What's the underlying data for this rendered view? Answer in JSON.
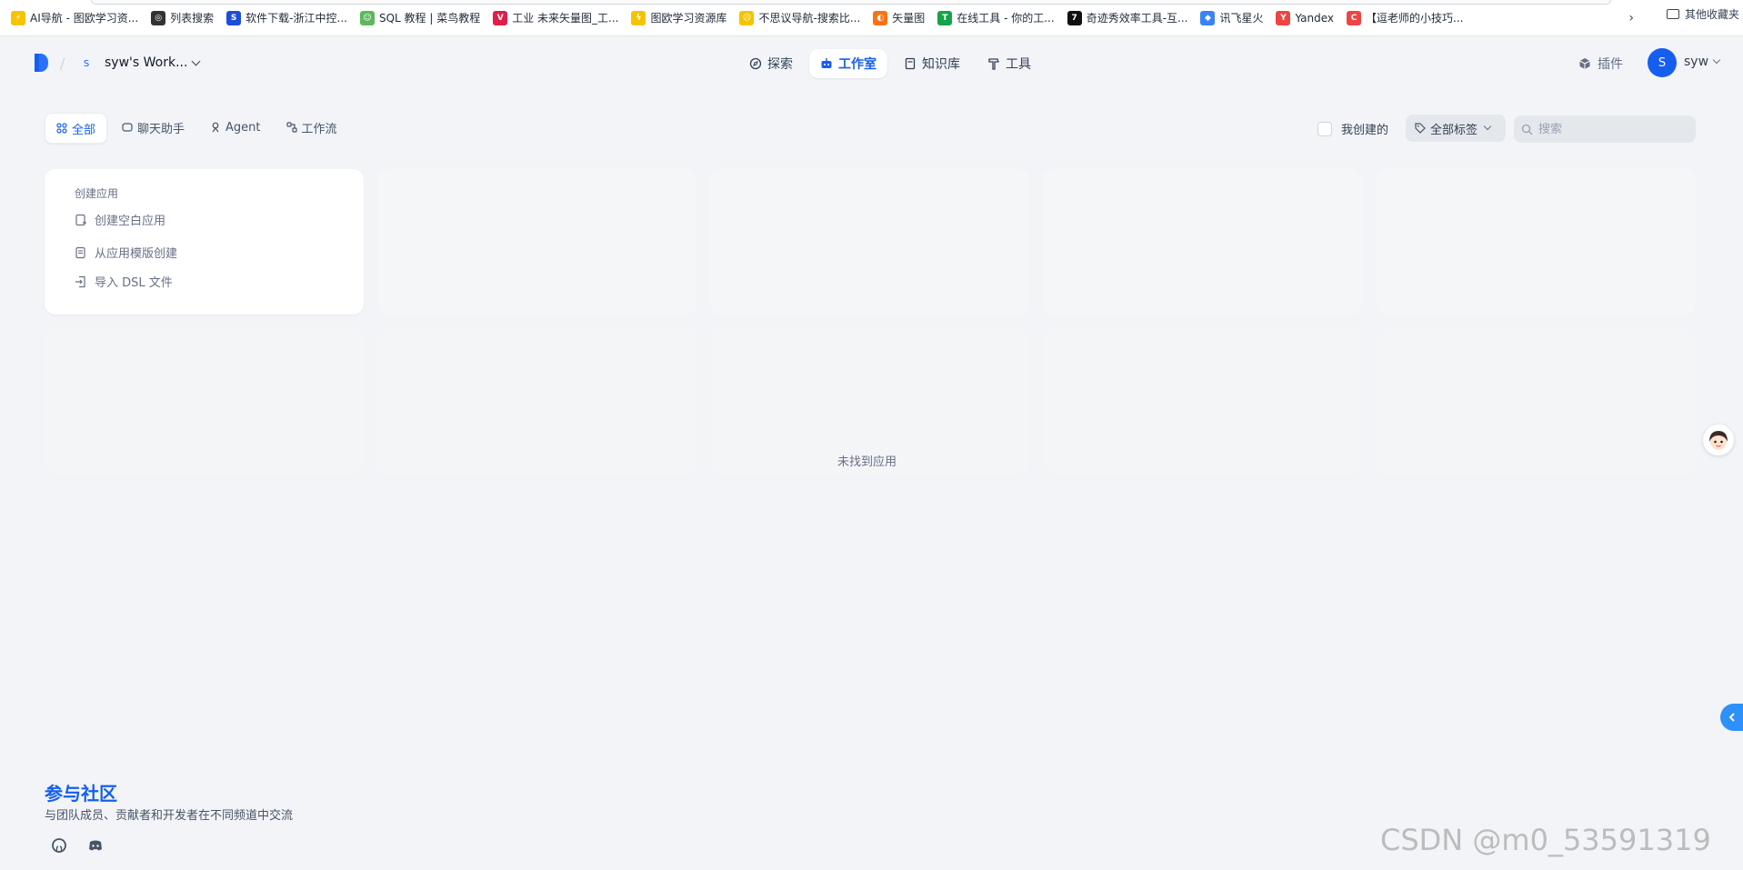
{
  "bookmarks": {
    "items": [
      {
        "label": "AI导航 - 图欧学习资...",
        "icon": "bolt-icon",
        "color": "#f5c400"
      },
      {
        "label": "列表搜索",
        "icon": "globe-icon",
        "color": "#333333"
      },
      {
        "label": "软件下载-浙江中控...",
        "icon": "supcon-icon",
        "color": "#1d4ed8"
      },
      {
        "label": "SQL 教程 | 菜鸟教程",
        "icon": "runoob-icon",
        "color": "#5cb85c"
      },
      {
        "label": "工业 未来矢量图_工...",
        "icon": "vcg-icon",
        "color": "#e11d48"
      },
      {
        "label": "图欧学习资源库",
        "icon": "lightning-icon",
        "color": "#f5c400"
      },
      {
        "label": "不思议导航-搜索比...",
        "icon": "face-icon",
        "color": "#f5c400"
      },
      {
        "label": "矢量图",
        "icon": "vector-icon",
        "color": "#f97316"
      },
      {
        "label": "在线工具 - 你的工...",
        "icon": "tool-icon",
        "color": "#16a34a"
      },
      {
        "label": "奇迹秀效率工具-互...",
        "icon": "seven-icon",
        "color": "#111111"
      },
      {
        "label": "讯飞星火",
        "icon": "spark-icon",
        "color": "#3b82f6"
      },
      {
        "label": "Yandex",
        "icon": "yandex-icon",
        "color": "#ef4444"
      },
      {
        "label": "【逗老师的小技巧...",
        "icon": "c-icon",
        "color": "#ef4444"
      }
    ],
    "other_label": "其他收藏夹"
  },
  "header": {
    "workspace_initial": "S",
    "workspace_name": "syw's Work...",
    "nav": [
      {
        "label": "探索",
        "icon": "compass-icon"
      },
      {
        "label": "工作室",
        "icon": "robot-icon"
      },
      {
        "label": "知识库",
        "icon": "book-icon"
      },
      {
        "label": "工具",
        "icon": "hammer-icon"
      }
    ],
    "plugins_label": "插件",
    "user_initial": "S",
    "user_name": "syw"
  },
  "filters": {
    "tabs": [
      {
        "label": "全部",
        "icon": "grid-icon"
      },
      {
        "label": "聊天助手",
        "icon": "chat-icon"
      },
      {
        "label": "Agent",
        "icon": "agent-icon"
      },
      {
        "label": "工作流",
        "icon": "workflow-icon"
      }
    ],
    "mine_label": "我创建的",
    "tags_label": "全部标签",
    "search_placeholder": "搜索"
  },
  "create": {
    "title": "创建应用",
    "blank": "创建空白应用",
    "template": "从应用模版创建",
    "dsl": "导入 DSL 文件"
  },
  "empty_text": "未找到应用",
  "community": {
    "title": "参与社区",
    "desc": "与团队成员、贡献者和开发者在不同频道中交流"
  },
  "watermark": "CSDN @m0_53591319",
  "colors": {
    "accent": "#155eef",
    "page_bg": "#f2f4f7"
  }
}
